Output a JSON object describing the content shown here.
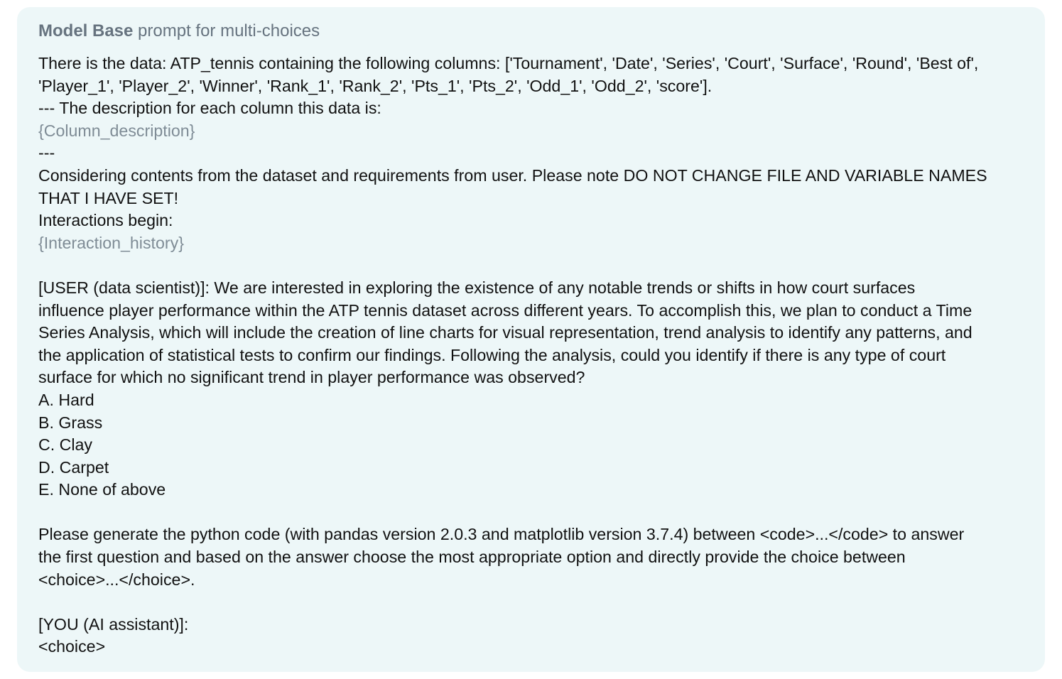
{
  "header": {
    "title_bold": "Model Base",
    "title_rest": " prompt for multi-choices"
  },
  "prompt": {
    "intro_line1": "There is the data: ATP_tennis containing the following columns: ['Tournament', 'Date', 'Series', 'Court', 'Surface', 'Round', 'Best of',",
    "intro_line2": "'Player_1', 'Player_2', 'Winner', 'Rank_1', 'Rank_2', 'Pts_1', 'Pts_2', 'Odd_1', 'Odd_2', 'score'].",
    "desc_header": "--- The description for each column this data is:",
    "column_placeholder": "{Column_description}",
    "separator": "---",
    "note_line1": "Considering contents from the dataset and requirements from user. Please note DO NOT CHANGE FILE AND VARIABLE NAMES",
    "note_line2": "THAT I HAVE SET!",
    "interactions_begin": "Interactions begin:",
    "history_placeholder": "{Interaction_history}",
    "user_lines": [
      "[USER (data scientist)]: We are interested in exploring the existence of any notable trends or shifts in how court surfaces",
      "influence player performance within the ATP tennis dataset across different years. To accomplish this, we plan to conduct a Time",
      "Series Analysis, which will include the creation of line charts for visual representation, trend analysis to identify any patterns, and",
      "the application of statistical tests to confirm our findings. Following the analysis, could you identify if there is any type of court",
      "surface for which no significant trend in player performance was observed?"
    ],
    "options": [
      "A. Hard",
      "B. Grass",
      "C. Clay",
      "D. Carpet",
      "E. None of above"
    ],
    "instruction_lines": [
      "Please generate the python code (with pandas version 2.0.3 and matplotlib version 3.7.4) between <code>...</code> to answer",
      "the first question and based on the answer choose the most appropriate option and directly provide the choice between",
      "<choice>...</choice>."
    ],
    "assistant_label": "[YOU (AI assistant)]:",
    "choice_tag": "<choice>"
  }
}
